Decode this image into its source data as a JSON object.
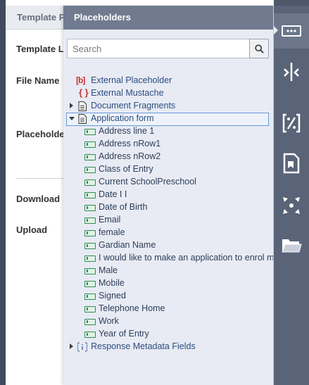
{
  "background": {
    "header_title": "Template P",
    "labels": {
      "template": "Template L",
      "file_name": "File Name",
      "placeholders": "Placeholder",
      "download": "Download",
      "upload": "Upload"
    }
  },
  "panel": {
    "title": "Placeholders",
    "search": {
      "placeholder": "Search",
      "value": ""
    },
    "tree": {
      "external_placeholder": {
        "icon_text": "[b]",
        "label": "External Placeholder"
      },
      "external_mustache": {
        "icon_text": "{ }",
        "label": "External Mustache"
      },
      "document_fragments": {
        "label": "Document Fragments",
        "expanded": false
      },
      "application_form": {
        "label": "Application form",
        "expanded": true,
        "selected": true,
        "fields": [
          "Address line 1",
          "Address nRow1",
          "Address nRow2",
          "Class of Entry",
          "Current SchoolPreschool",
          "Date I I",
          "Date of Birth",
          "Email",
          "female",
          "Gardian Name",
          "I would like to make an application to enrol my child",
          "Male",
          "Mobile",
          "Signed",
          "Telephone Home",
          "Work",
          "Year of Entry"
        ]
      },
      "response_metadata": {
        "label": "Response Metadata Fields",
        "expanded": false
      }
    }
  },
  "toolbar": {
    "buttons": [
      {
        "name": "placeholders-icon",
        "active": true
      },
      {
        "name": "merge-icon",
        "active": false
      },
      {
        "name": "formula-icon",
        "active": false
      },
      {
        "name": "bookmark-document-icon",
        "active": false
      },
      {
        "name": "expand-arrows-icon",
        "active": false
      },
      {
        "name": "folder-icon",
        "active": false
      }
    ]
  },
  "colors": {
    "panel_header": "#707b90",
    "toolbar": "#5a6478",
    "link_text": "#2c4d80",
    "external_icon": "#cc3333",
    "field_icon": "#2f8a55",
    "selection_border": "#6a98d6"
  }
}
